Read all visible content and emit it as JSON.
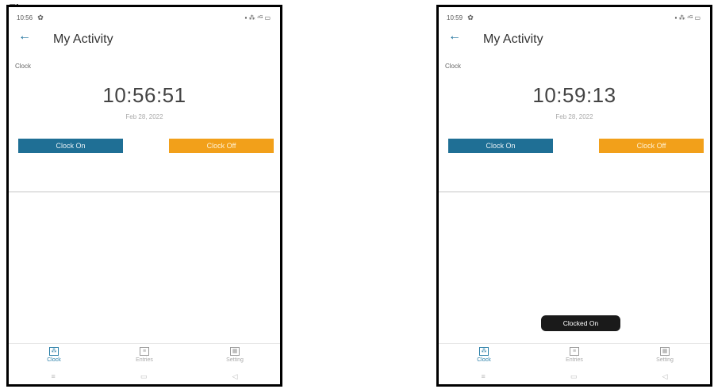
{
  "caption": "Figure",
  "screens": [
    {
      "status": {
        "time": "10:56",
        "right": "▪ ⁂ ⁴ᴳ ▭"
      },
      "app_bar": {
        "back": "←",
        "title": "My Activity"
      },
      "section_label": "Clock",
      "clock": {
        "time": "10:56:51",
        "date": "Feb 28, 2022"
      },
      "buttons": {
        "clock_on": "Clock On",
        "clock_off": "Clock Off"
      },
      "toast": "",
      "nav": [
        {
          "label": "Clock",
          "active": true
        },
        {
          "label": "Entries",
          "active": false
        },
        {
          "label": "Setting",
          "active": false
        }
      ],
      "sysnav": [
        "≡",
        "▭",
        "◁"
      ]
    },
    {
      "status": {
        "time": "10:59",
        "right": "▪ ⁂ ⁴ᴳ ▭"
      },
      "app_bar": {
        "back": "←",
        "title": "My Activity"
      },
      "section_label": "Clock",
      "clock": {
        "time": "10:59:13",
        "date": "Feb 28, 2022"
      },
      "buttons": {
        "clock_on": "Clock On",
        "clock_off": "Clock Off"
      },
      "toast": "Clocked On",
      "nav": [
        {
          "label": "Clock",
          "active": true
        },
        {
          "label": "Entries",
          "active": false
        },
        {
          "label": "Setting",
          "active": false
        }
      ],
      "sysnav": [
        "≡",
        "▭",
        "◁"
      ]
    }
  ]
}
